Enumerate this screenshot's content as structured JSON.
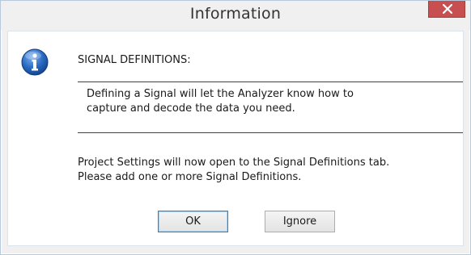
{
  "window": {
    "title": "Information",
    "close_icon": "close-icon"
  },
  "message": {
    "icon": "info-icon",
    "heading": "SIGNAL DEFINITIONS:",
    "detail_lines": [
      "Defining a Signal will let the Analyzer know how to",
      "capture and decode the data you need."
    ],
    "note_lines": [
      "Project Settings will now open to the Signal Definitions tab.",
      "Please add one or more Signal Definitions."
    ]
  },
  "buttons": {
    "ok_label": "OK",
    "ignore_label": "Ignore"
  },
  "colors": {
    "close_button": "#c74f50",
    "info_icon_blue": "#1e5fb4",
    "default_button_border": "#3c7fb1"
  }
}
